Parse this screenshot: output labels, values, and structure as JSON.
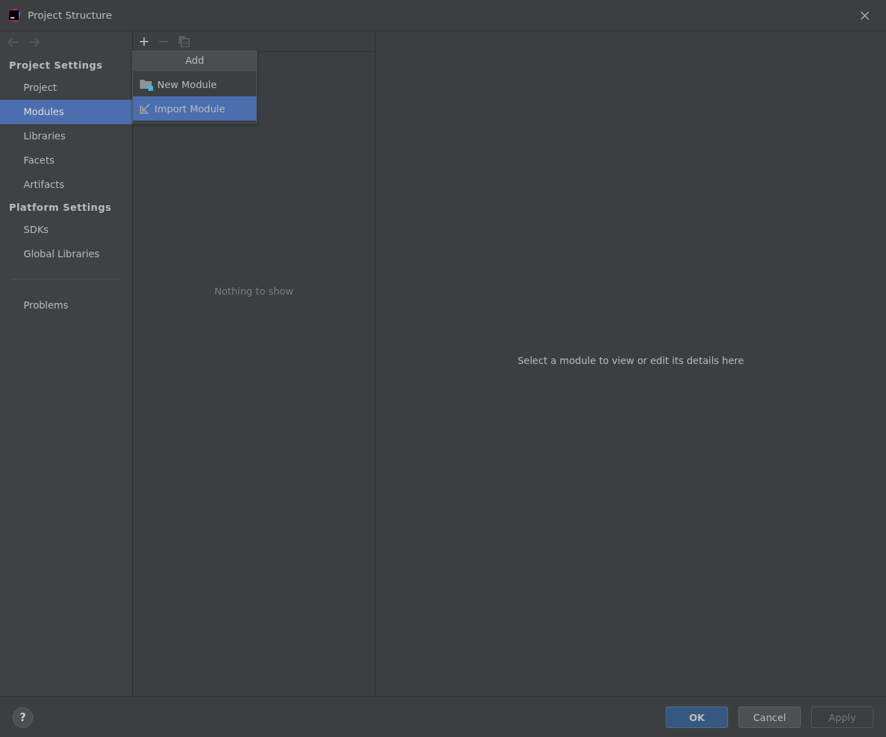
{
  "window": {
    "title": "Project Structure"
  },
  "navigation": {
    "back_disabled": true,
    "forward_disabled": true
  },
  "sidebar": {
    "sections": [
      {
        "heading": "Project Settings",
        "items": [
          {
            "label": "Project",
            "selected": false
          },
          {
            "label": "Modules",
            "selected": true
          },
          {
            "label": "Libraries",
            "selected": false
          },
          {
            "label": "Facets",
            "selected": false
          },
          {
            "label": "Artifacts",
            "selected": false
          }
        ]
      },
      {
        "heading": "Platform Settings",
        "items": [
          {
            "label": "SDKs",
            "selected": false
          },
          {
            "label": "Global Libraries",
            "selected": false
          }
        ]
      }
    ],
    "footer_items": [
      {
        "label": "Problems",
        "selected": false
      }
    ]
  },
  "toolbar": [
    {
      "kind": "add",
      "disabled": false
    },
    {
      "kind": "remove",
      "disabled": true
    },
    {
      "kind": "copy",
      "disabled": true
    }
  ],
  "add_menu": {
    "title": "Add",
    "items": [
      {
        "label": "New Module",
        "kind": "new",
        "selected": false
      },
      {
        "label": "Import Module",
        "kind": "import",
        "selected": true
      }
    ]
  },
  "module_list": {
    "empty_text": "Nothing to show"
  },
  "details": {
    "empty_text": "Select a module to view or edit its details here"
  },
  "footer": {
    "help": "?",
    "buttons": [
      {
        "label": "OK",
        "kind": "default",
        "disabled": false
      },
      {
        "label": "Cancel",
        "kind": "normal",
        "disabled": false
      },
      {
        "label": "Apply",
        "kind": "normal",
        "disabled": true
      }
    ]
  }
}
